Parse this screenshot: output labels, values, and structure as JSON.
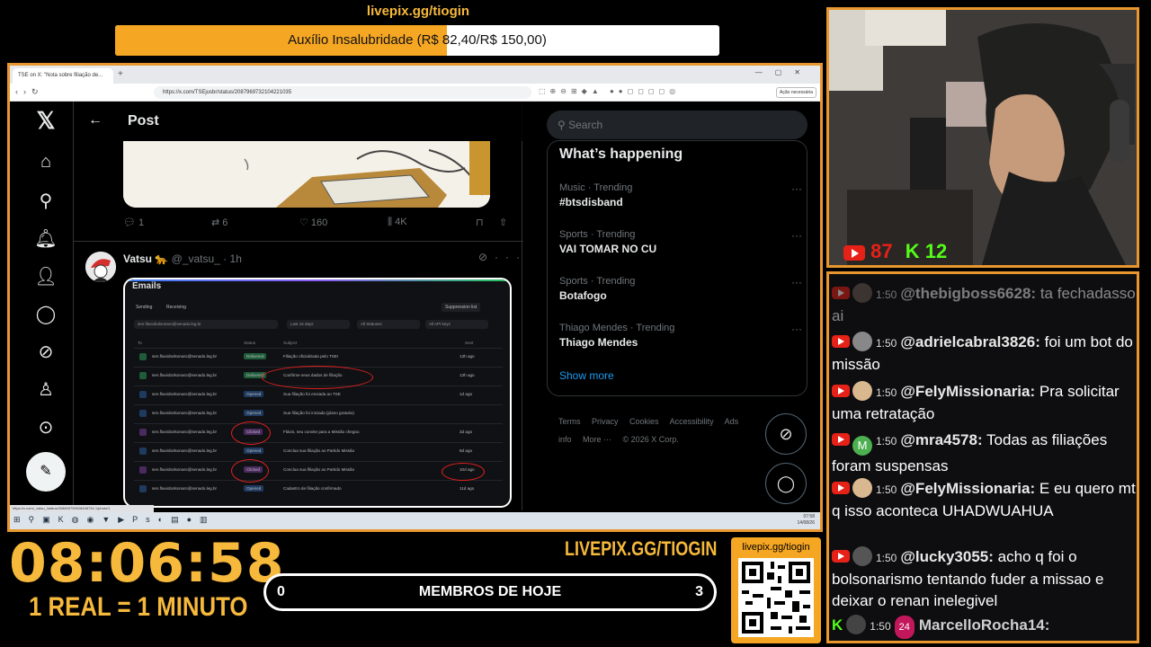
{
  "goal": {
    "url": "livepix.gg/tiogin",
    "text": "Auxílio Insalubridade (R$ 82,40/R$ 150,00)",
    "progress": 0.549
  },
  "browser": {
    "tab_title": "TSE on X: \"Nota sobre filiação de...",
    "address": "https://x.com/TSEjusbr/status/2087969732104221035",
    "ext_button": "Ação necessária",
    "status_url": "https://x.com/_vatsu_/status/208809799028408734 1/photo/1"
  },
  "xnav": {
    "items": [
      "home-icon",
      "search-icon",
      "bell-icon",
      "follow-icon",
      "chat-icon",
      "grok-icon",
      "profile-icon",
      "more-icon"
    ]
  },
  "post": {
    "header_title": "Post",
    "actions": {
      "replies": "1",
      "reposts": "6",
      "likes": "160",
      "views": "4K"
    }
  },
  "tweet": {
    "name": "Vatsu",
    "emoji": "🐆",
    "handle": "@_vatsu_",
    "time": "· 1h"
  },
  "emails": {
    "title": "Emails",
    "tabs": [
      "Sending",
      "Receiving"
    ],
    "suppression": "Suppression list",
    "filters": [
      "sen.flaviobolsonaro@senado.leg.br",
      "Last 15 days",
      "All Statuses",
      "All API keys"
    ],
    "columns": [
      "To",
      "Status",
      "Subject",
      "Sent"
    ],
    "rows": [
      {
        "to": "sen.flaviobolsonaro@senado.leg.br",
        "status": "Delivered",
        "subject": "Filiação oficializada pelo TSE!",
        "sent": "13h ago"
      },
      {
        "to": "sen.flaviobolsonaro@senado.leg.br",
        "status": "Delivered",
        "subject": "Confirme seus dados de filiação",
        "sent": "13h ago"
      },
      {
        "to": "sen.flaviobolsonaro@senado.leg.br",
        "status": "Opened",
        "subject": "Sua filiação foi enviada ao TSE",
        "sent": "1d ago"
      },
      {
        "to": "sen.flaviobolsonaro@senado.leg.br",
        "status": "Opened",
        "subject": "Sua filiação foi iniciada (plano gratuito)",
        "sent": ""
      },
      {
        "to": "sen.flaviobolsonaro@senado.leg.br",
        "status": "Clicked",
        "subject": "Flávio, seu convite para a Missão chegou",
        "sent": "3d ago"
      },
      {
        "to": "sen.flaviobolsonaro@senado.leg.br",
        "status": "Opened",
        "subject": "Conclua sua filiação ao Partido Missão",
        "sent": "8d ago"
      },
      {
        "to": "sen.flaviobolsonaro@senado.leg.br",
        "status": "Clicked",
        "subject": "Conclua sua filiação ao Partido Missão",
        "sent": "10d ago"
      },
      {
        "to": "sen.flaviobolsonaro@senado.leg.br",
        "status": "Opened",
        "subject": "Cadastro de filiação confirmado",
        "sent": "11d ago"
      }
    ]
  },
  "sidebar": {
    "search_placeholder": "Search",
    "trends_title": "What’s happening",
    "trends": [
      {
        "category": "Music · Trending",
        "name": "#btsdisband"
      },
      {
        "category": "Sports · Trending",
        "name": "VAI TOMAR NO CU"
      },
      {
        "category": "Sports · Trending",
        "name": "Botafogo"
      },
      {
        "category": "Thiago Mendes · Trending",
        "name": "Thiago Mendes"
      }
    ],
    "show_more": "Show more",
    "footer": [
      "Terms",
      "Privacy",
      "Cookies",
      "Accessibility",
      "Ads info",
      "More ···",
      "© 2026 X Corp."
    ]
  },
  "taskbar": {
    "time": "07:58",
    "date": "14/08/26"
  },
  "overlay": {
    "clock": "08:06:58",
    "rate": "1 REAL = 1 MINUTO",
    "livepix": "LIVEPIX.GG/TIOGIN",
    "qr_label": "livepix.gg/tiogin",
    "members": {
      "label": "MEMBROS DE HOJE",
      "min": "0",
      "max": "3"
    }
  },
  "cam": {
    "youtube_viewers": "87",
    "kick_viewers": "12"
  },
  "chat": [
    {
      "time": "1:50",
      "user": "@thebigboss6628:",
      "text": "ta fechadasso ai",
      "faded": true,
      "avatar_color": "#6a5a50"
    },
    {
      "time": "1:50",
      "user": "@adrielcabral3826:",
      "text": "foi um bot do missão",
      "faded": false,
      "avatar_color": "#888888"
    },
    {
      "time": "1:50",
      "user": "@FelyMissionaria:",
      "text": "Pra solicitar uma retratação",
      "faded": false,
      "avatar_color": "#d9b890"
    },
    {
      "time": "1:50",
      "user": "@mra4578:",
      "text": "Todas as filiações foram suspensas",
      "faded": false,
      "avatar_color": "#4caf50",
      "initial": "M"
    },
    {
      "time": "1:50",
      "user": "@FelyMissionaria:",
      "text": "E eu quero mt q isso aconteca UHADWUAHUA",
      "faded": false,
      "avatar_color": "#d9b890"
    },
    {
      "time": "1:50",
      "user": "@lucky3055:",
      "text": "acho q foi o bolsonarismo tentando fuder a missao e deixar o renan inelegivel",
      "faded": false,
      "avatar_color": "#555555"
    },
    {
      "time": "1:50",
      "user": "MarcelloRocha14:",
      "text": "",
      "faded": false,
      "avatar_color": "#444444",
      "badge": "24"
    }
  ]
}
